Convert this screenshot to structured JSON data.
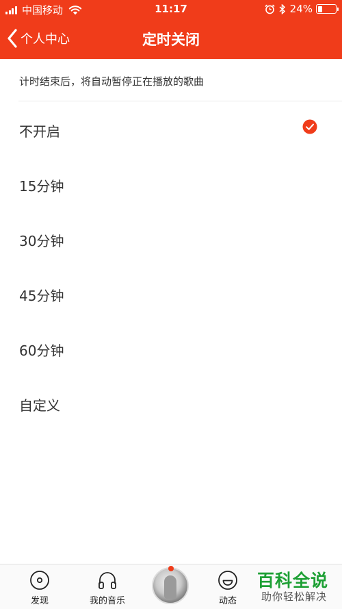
{
  "status_bar": {
    "carrier": "中国移动",
    "time": "11:17",
    "battery_pct": "24%",
    "battery_level": 0.24
  },
  "nav": {
    "back_label": "个人中心",
    "title": "定时关闭"
  },
  "hint": "计时结束后，将自动暂停正在播放的歌曲",
  "options": [
    {
      "label": "不开启",
      "selected": true
    },
    {
      "label": "15分钟",
      "selected": false
    },
    {
      "label": "30分钟",
      "selected": false
    },
    {
      "label": "45分钟",
      "selected": false
    },
    {
      "label": "60分钟",
      "selected": false
    },
    {
      "label": "自定义",
      "selected": false
    }
  ],
  "tabs": [
    {
      "label": "发现",
      "icon": "disc-icon"
    },
    {
      "label": "我的音乐",
      "icon": "headphones-icon"
    },
    {
      "label": "动态",
      "icon": "smiley-icon"
    }
  ],
  "watermark": {
    "title": "百科全说",
    "subtitle": "助你轻松解决"
  },
  "colors": {
    "accent": "#f03c1a",
    "watermark_green": "#1ea035"
  }
}
